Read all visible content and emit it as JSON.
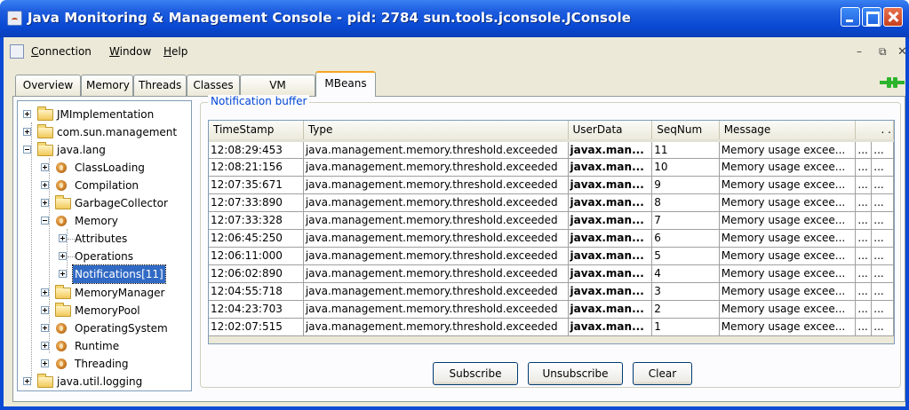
{
  "window": {
    "title": "Java Monitoring & Management Console - pid: 2784 sun.tools.jconsole.JConsole"
  },
  "menu": {
    "connection_label": "onnection",
    "connection_mnemonic": "C",
    "window_label": "indow",
    "window_mnemonic": "W",
    "help_label": "elp",
    "help_mnemonic": "H"
  },
  "tabs": [
    {
      "label": "Overview"
    },
    {
      "label": "Memory"
    },
    {
      "label": "Threads"
    },
    {
      "label": "Classes"
    },
    {
      "label": "VM Summary"
    },
    {
      "label": "MBeans",
      "active": true
    }
  ],
  "tree": {
    "items": [
      {
        "label": "JMImplementation"
      },
      {
        "label": "com.sun.management"
      },
      {
        "label": "java.lang"
      },
      {
        "label": "ClassLoading"
      },
      {
        "label": "Compilation"
      },
      {
        "label": "GarbageCollector"
      },
      {
        "label": "Memory"
      },
      {
        "label": "Attributes"
      },
      {
        "label": "Operations"
      },
      {
        "label": "Notifications[11]",
        "selected": true
      },
      {
        "label": "MemoryManager"
      },
      {
        "label": "MemoryPool"
      },
      {
        "label": "OperatingSystem"
      },
      {
        "label": "Runtime"
      },
      {
        "label": "Threading"
      },
      {
        "label": "java.util.logging"
      }
    ]
  },
  "notifications": {
    "legend": "Notification buffer",
    "columns": [
      "TimeStamp",
      "Type",
      "UserData",
      "SeqNum",
      "Message",
      ". ."
    ],
    "rows": [
      {
        "timestamp": "12:08:29:453",
        "type": "java.management.memory.threshold.exceeded",
        "userdata": "javax.man...",
        "seqnum": "11",
        "message": "Memory usage excee...",
        "e1": "...",
        "e2": "..."
      },
      {
        "timestamp": "12:08:21:156",
        "type": "java.management.memory.threshold.exceeded",
        "userdata": "javax.man...",
        "seqnum": "10",
        "message": "Memory usage excee...",
        "e1": "...",
        "e2": "..."
      },
      {
        "timestamp": "12:07:35:671",
        "type": "java.management.memory.threshold.exceeded",
        "userdata": "javax.man...",
        "seqnum": "9",
        "message": "Memory usage excee...",
        "e1": "...",
        "e2": "..."
      },
      {
        "timestamp": "12:07:33:890",
        "type": "java.management.memory.threshold.exceeded",
        "userdata": "javax.man...",
        "seqnum": "8",
        "message": "Memory usage excee...",
        "e1": "...",
        "e2": "..."
      },
      {
        "timestamp": "12:07:33:328",
        "type": "java.management.memory.threshold.exceeded",
        "userdata": "javax.man...",
        "seqnum": "7",
        "message": "Memory usage excee...",
        "e1": "...",
        "e2": "..."
      },
      {
        "timestamp": "12:06:45:250",
        "type": "java.management.memory.threshold.exceeded",
        "userdata": "javax.man...",
        "seqnum": "6",
        "message": "Memory usage excee...",
        "e1": "...",
        "e2": "..."
      },
      {
        "timestamp": "12:06:11:000",
        "type": "java.management.memory.threshold.exceeded",
        "userdata": "javax.man...",
        "seqnum": "5",
        "message": "Memory usage excee...",
        "e1": "...",
        "e2": "..."
      },
      {
        "timestamp": "12:06:02:890",
        "type": "java.management.memory.threshold.exceeded",
        "userdata": "javax.man...",
        "seqnum": "4",
        "message": "Memory usage excee...",
        "e1": "...",
        "e2": "..."
      },
      {
        "timestamp": "12:04:55:718",
        "type": "java.management.memory.threshold.exceeded",
        "userdata": "javax.man...",
        "seqnum": "3",
        "message": "Memory usage excee...",
        "e1": "...",
        "e2": "..."
      },
      {
        "timestamp": "12:04:23:703",
        "type": "java.management.memory.threshold.exceeded",
        "userdata": "javax.man...",
        "seqnum": "2",
        "message": "Memory usage excee...",
        "e1": "...",
        "e2": "..."
      },
      {
        "timestamp": "12:02:07:515",
        "type": "java.management.memory.threshold.exceeded",
        "userdata": "javax.man...",
        "seqnum": "1",
        "message": "Memory usage excee...",
        "e1": "...",
        "e2": "..."
      }
    ]
  },
  "buttons": {
    "subscribe": "Subscribe",
    "unsubscribe": "Unsubscribe",
    "clear": "Clear"
  },
  "colors": {
    "titlebar": "#0a4ad4",
    "selection": "#316ac5",
    "legend_text": "#0046d5",
    "connected_indicator": "#2db42d"
  },
  "icons": {
    "app": "java-cup-icon",
    "folder": "folder-icon",
    "mbean": "bean-icon",
    "connection": "plug-connected-icon"
  }
}
